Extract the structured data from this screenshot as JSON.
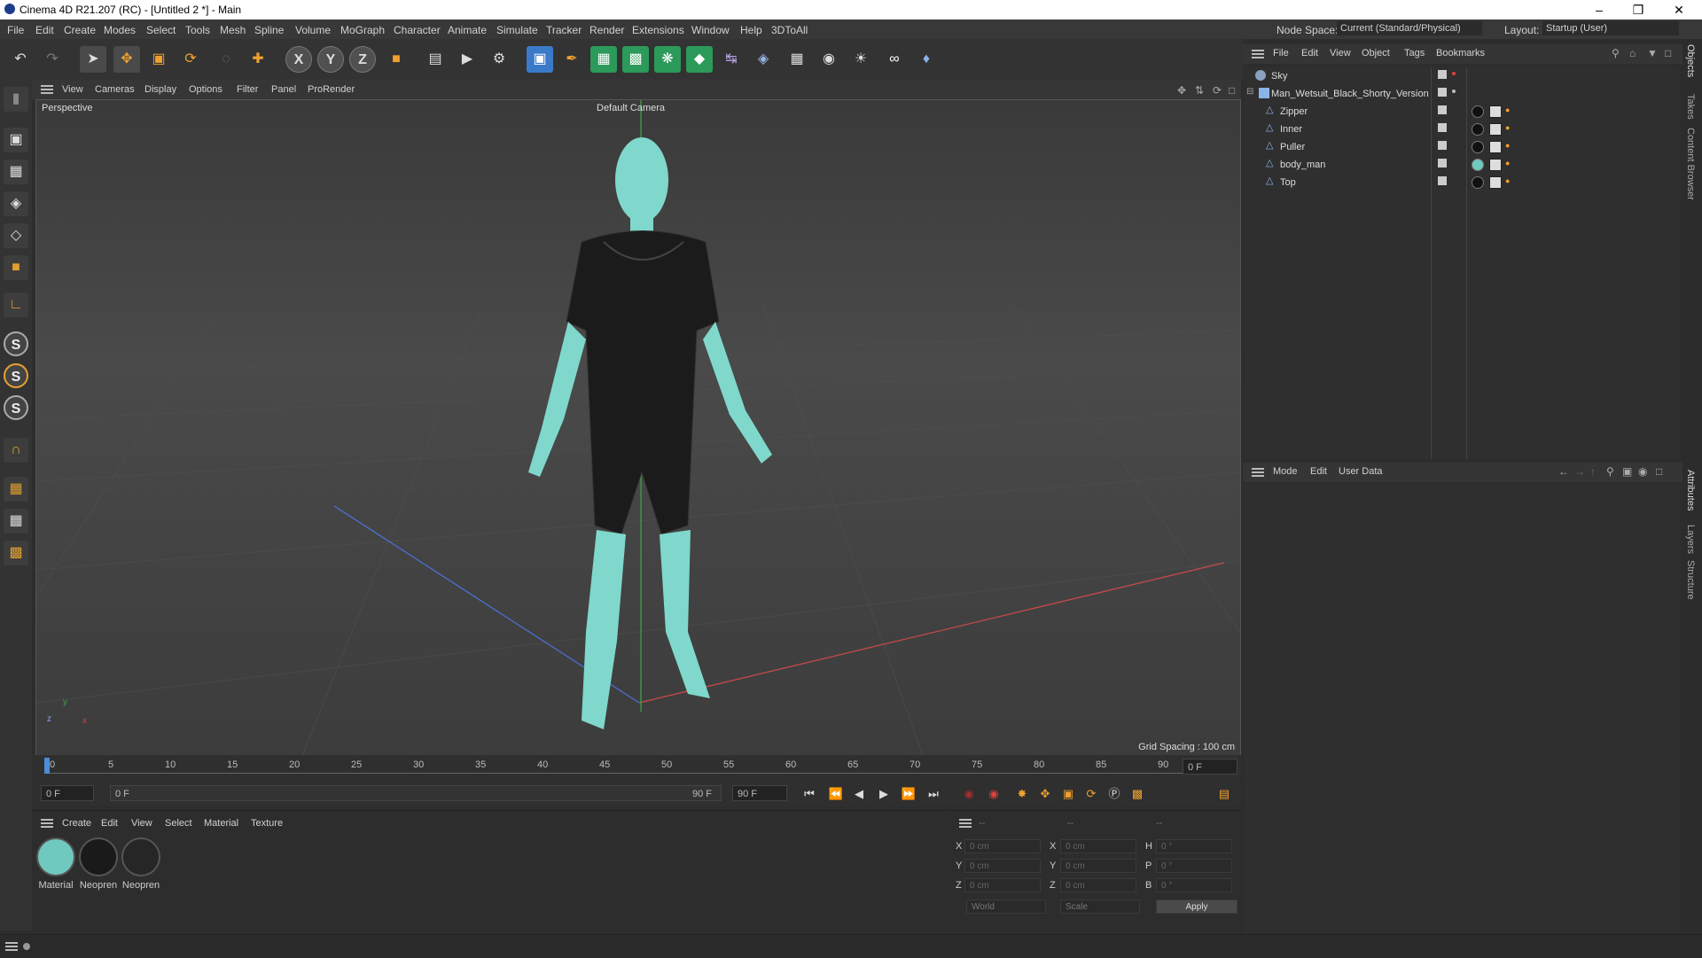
{
  "window": {
    "title": "Cinema 4D R21.207 (RC) - [Untitled 2 *] - Main"
  },
  "menubar": {
    "items": [
      "File",
      "Edit",
      "Create",
      "Modes",
      "Select",
      "Tools",
      "Mesh",
      "Spline",
      "Volume",
      "MoGraph",
      "Character",
      "Animate",
      "Simulate",
      "Tracker",
      "Render",
      "Extensions",
      "Window",
      "Help",
      "3DToAll"
    ],
    "node_space_label": "Node Space:",
    "node_space_value": "Current (Standard/Physical)",
    "layout_label": "Layout:",
    "layout_value": "Startup (User)"
  },
  "toolbar": {
    "axis_x": "X",
    "axis_y": "Y",
    "axis_z": "Z"
  },
  "left_toolbar": {
    "s1": "S",
    "s2": "S",
    "s3": "S"
  },
  "viewport": {
    "menu": [
      "View",
      "Cameras",
      "Display",
      "Options",
      "Filter",
      "Panel",
      "ProRender"
    ],
    "label": "Perspective",
    "camera": "Default Camera",
    "grid_spacing": "Grid Spacing : 100 cm",
    "axis_y": "y",
    "axis_z": "z",
    "axis_x": "x"
  },
  "timeline": {
    "ticks": [
      "0",
      "5",
      "10",
      "15",
      "20",
      "25",
      "30",
      "35",
      "40",
      "45",
      "50",
      "55",
      "60",
      "65",
      "70",
      "75",
      "80",
      "85",
      "90"
    ],
    "current_frame": "0 F"
  },
  "transport": {
    "start": "0 F",
    "range_start": "0 F",
    "range_end": "90 F",
    "end": "90 F"
  },
  "material_manager": {
    "menu": [
      "Create",
      "Edit",
      "View",
      "Select",
      "Material",
      "Texture"
    ],
    "materials": [
      {
        "name": "Material",
        "color": "#6fc9bf"
      },
      {
        "name": "Neopren",
        "color": "#1a1a1a"
      },
      {
        "name": "Neopren",
        "color": "#262626"
      }
    ]
  },
  "coordinates": {
    "col1": "--",
    "col2": "--",
    "col3": "--",
    "rows": [
      {
        "l1": "X",
        "v1": "0 cm",
        "l2": "X",
        "v2": "0 cm",
        "l3": "H",
        "v3": "0 °"
      },
      {
        "l1": "Y",
        "v1": "0 cm",
        "l2": "Y",
        "v2": "0 cm",
        "l3": "P",
        "v3": "0 °"
      },
      {
        "l1": "Z",
        "v1": "0 cm",
        "l2": "Z",
        "v2": "0 cm",
        "l3": "B",
        "v3": "0 °"
      }
    ],
    "world": "World",
    "scale": "Scale",
    "apply": "Apply"
  },
  "object_manager": {
    "menu": [
      "File",
      "Edit",
      "View",
      "Object",
      "Tags",
      "Bookmarks"
    ],
    "objects": [
      {
        "name": "Sky"
      },
      {
        "name": "Man_Wetsuit_Black_Shorty_Version"
      },
      {
        "name": "Zipper"
      },
      {
        "name": "Inner"
      },
      {
        "name": "Puller"
      },
      {
        "name": "body_man"
      },
      {
        "name": "Top"
      }
    ]
  },
  "attribute_manager": {
    "menu": [
      "Mode",
      "Edit",
      "User Data"
    ]
  },
  "side_tabs": [
    "Objects",
    "Takes",
    "Content Browser",
    "Attributes",
    "Layers",
    "Structure"
  ]
}
